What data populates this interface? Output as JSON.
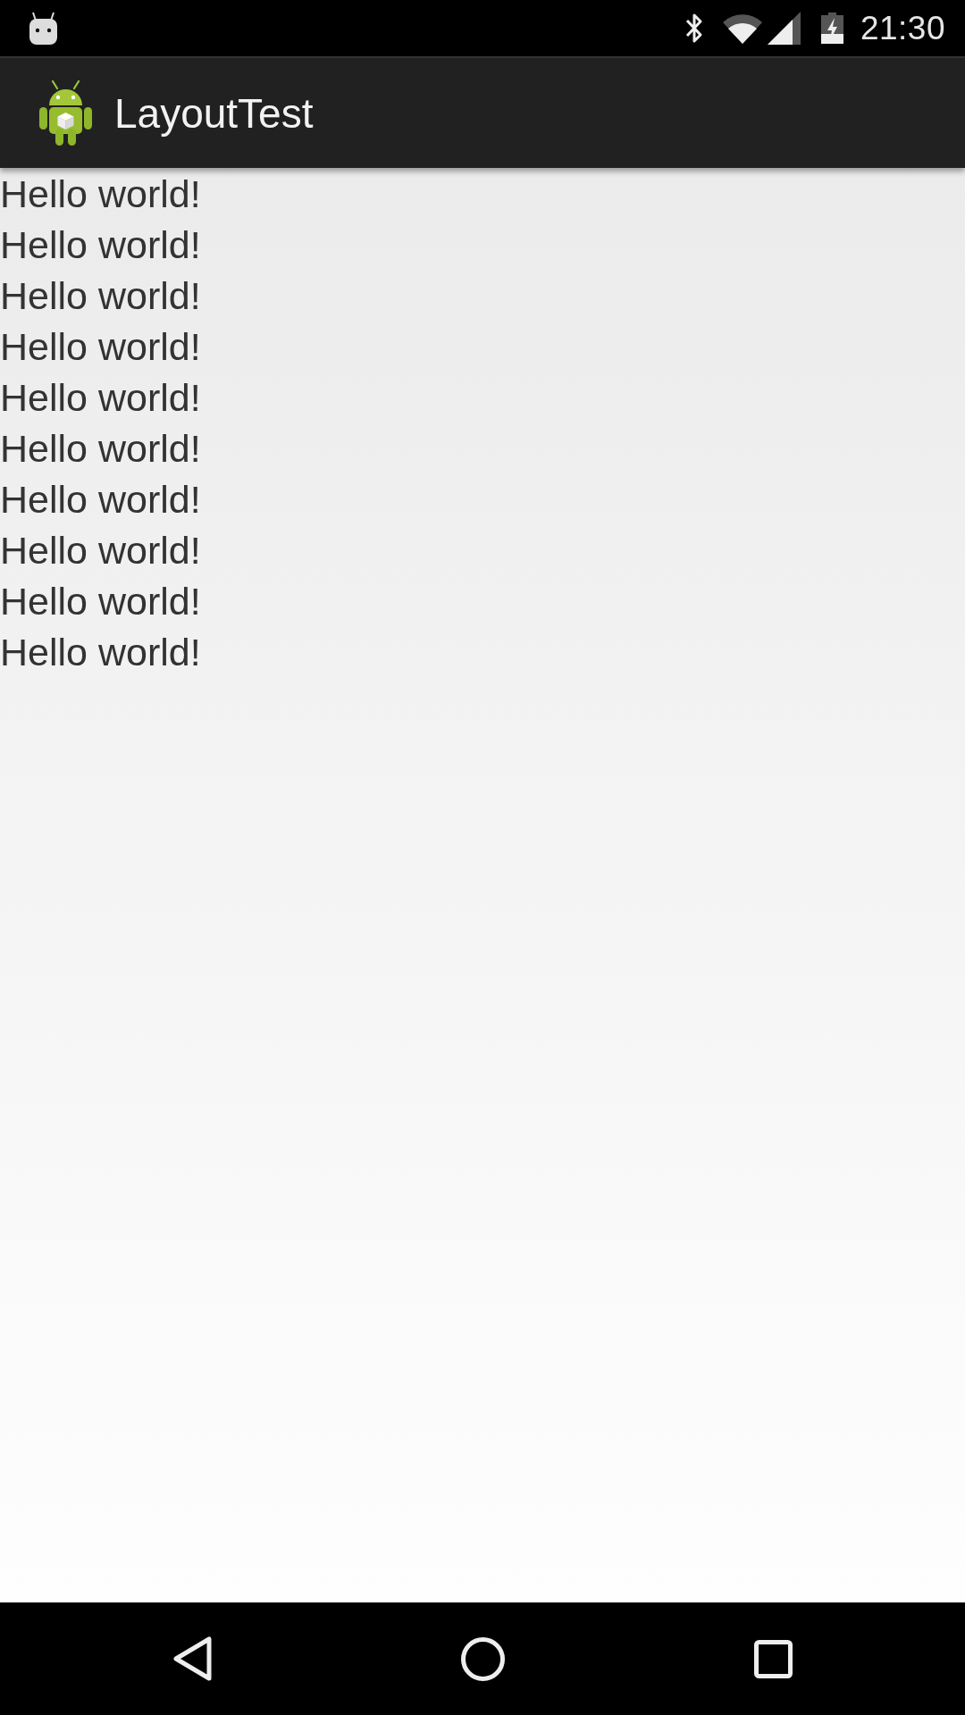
{
  "status_bar": {
    "time": "21:30"
  },
  "action_bar": {
    "title": "LayoutTest"
  },
  "lines": [
    "Hello world!",
    "Hello world!",
    "Hello world!",
    "Hello world!",
    "Hello world!",
    "Hello world!",
    "Hello world!",
    "Hello world!",
    "Hello world!",
    "Hello world!"
  ]
}
